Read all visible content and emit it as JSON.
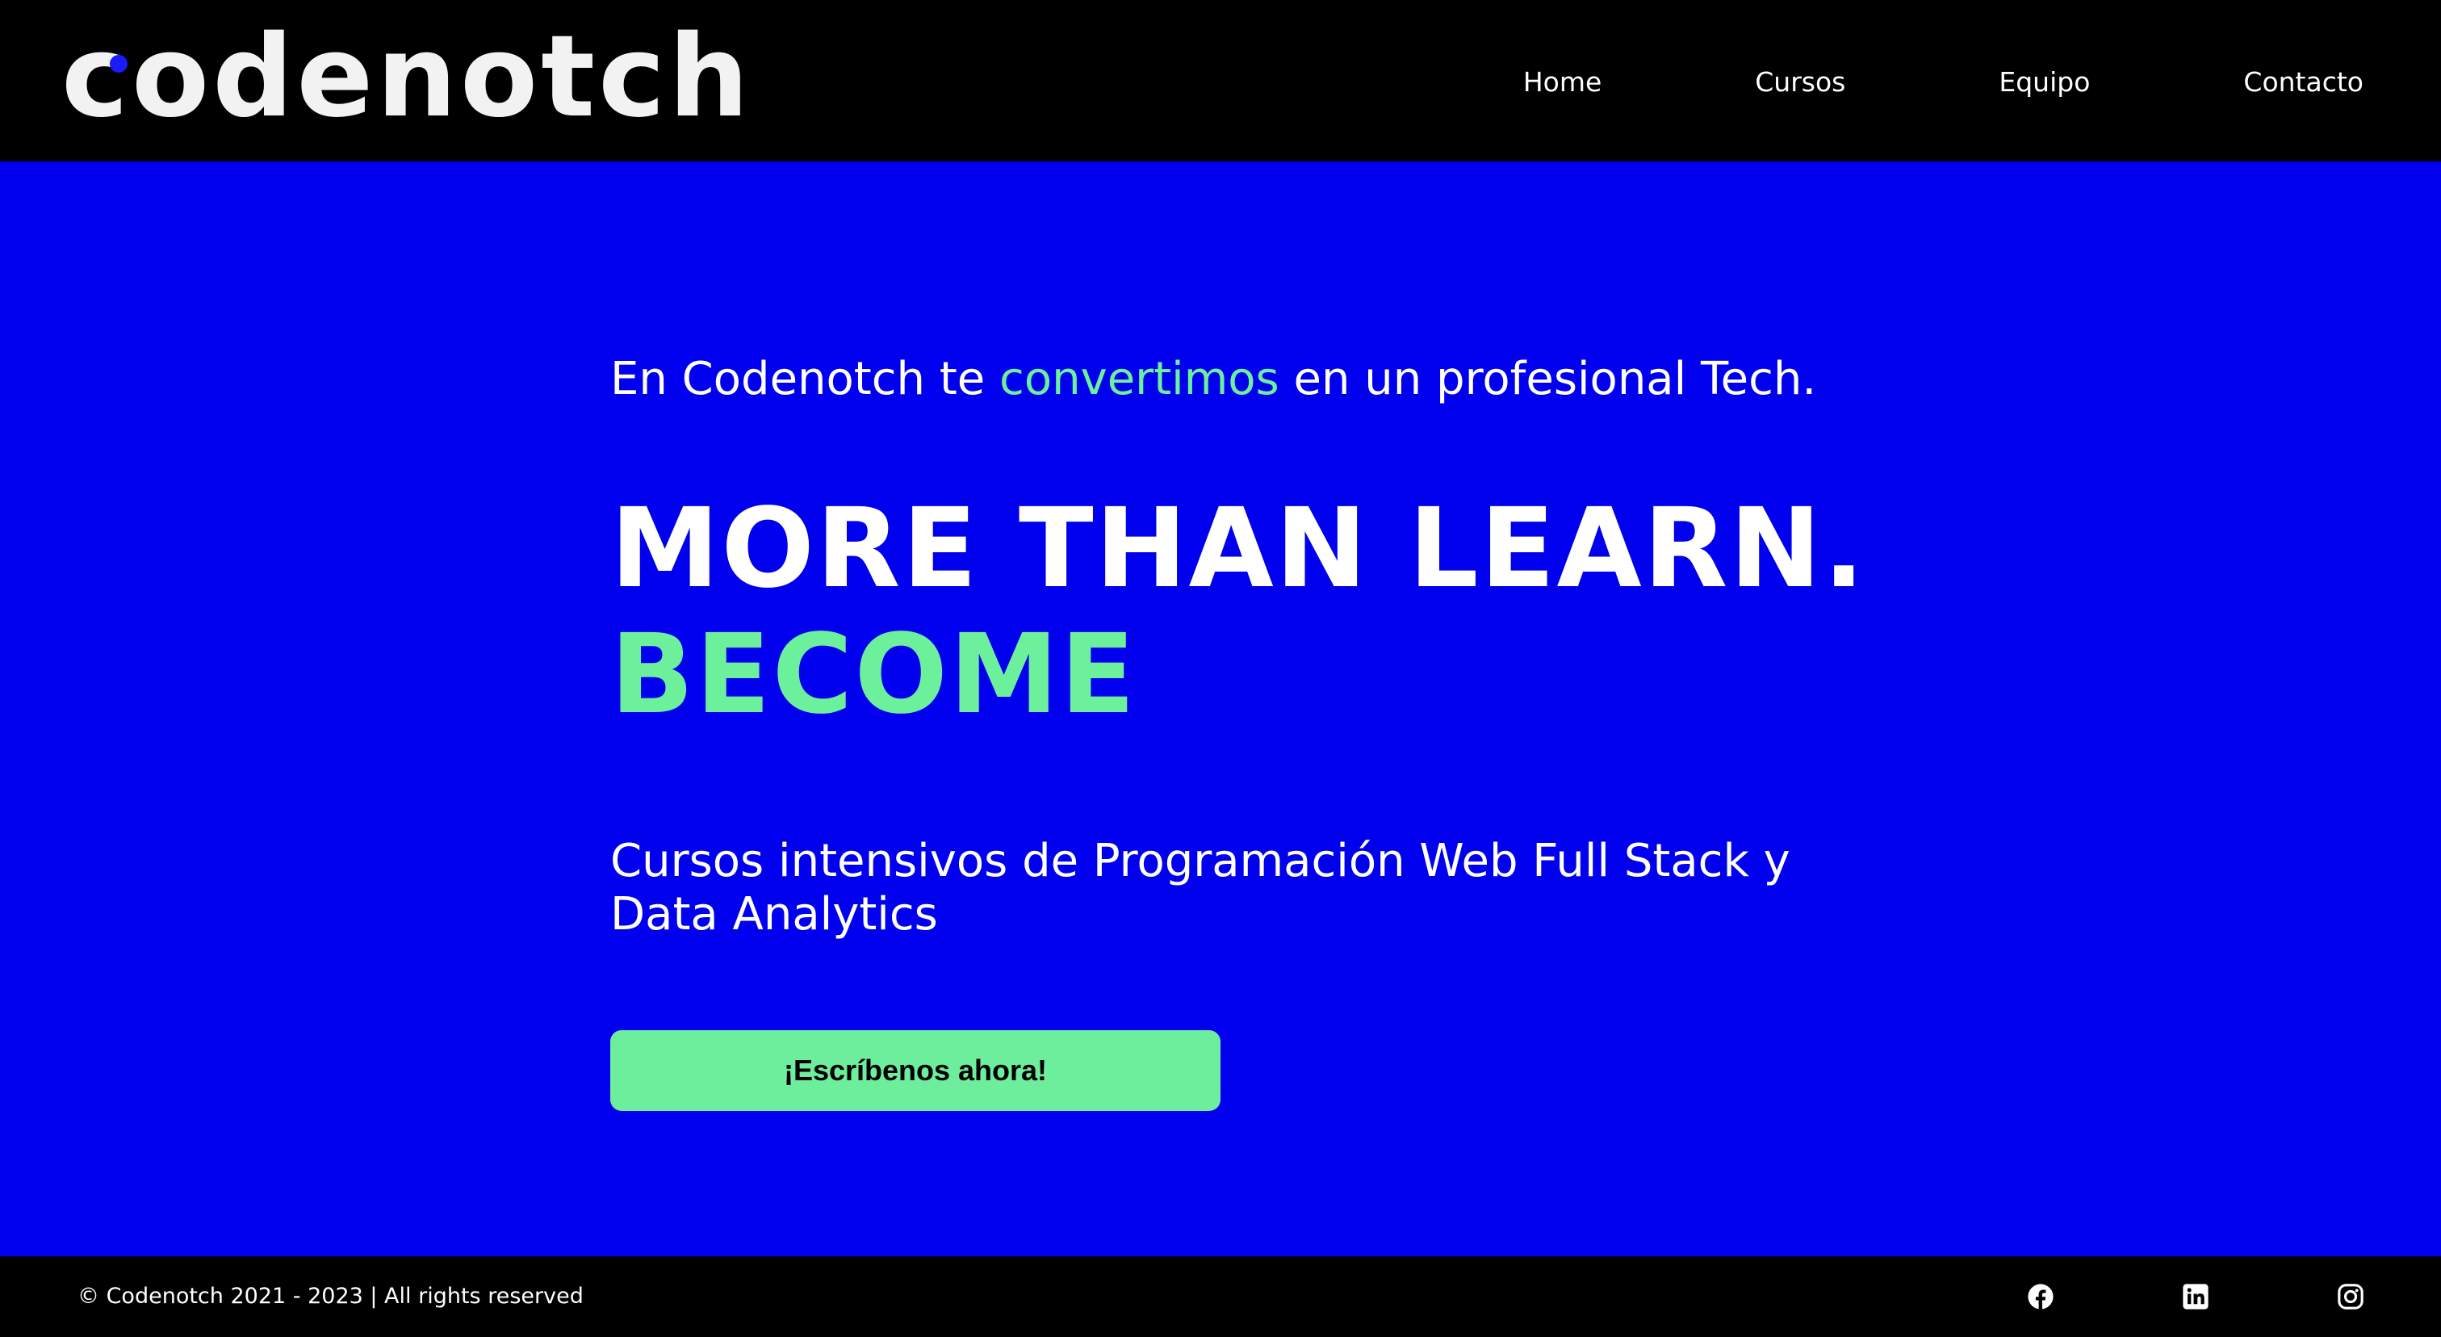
{
  "header": {
    "logo_text": "codenotch",
    "nav": [
      {
        "label": "Home"
      },
      {
        "label": "Cursos"
      },
      {
        "label": "Equipo"
      },
      {
        "label": "Contacto"
      }
    ]
  },
  "hero": {
    "tagline_before": "En Codenotch te ",
    "tagline_accent": "convertimos",
    "tagline_after": " en un profesional Tech.",
    "headline_line1": "MORE THAN LEARN.",
    "headline_line2": "BECOME",
    "subtitle": "Cursos intensivos de Programación Web Full Stack y Data Analytics",
    "cta_label": "¡Escríbenos ahora!"
  },
  "footer": {
    "copyright": "© Codenotch 2021 - 2023 | All rights reserved",
    "social_icons": [
      "facebook-icon",
      "linkedin-icon",
      "instagram-icon"
    ]
  },
  "colors": {
    "background": "#0000ee",
    "header_footer": "#000000",
    "accent": "#6cf09c",
    "text": "#ffffff",
    "logo_dot": "#1a1aff"
  }
}
